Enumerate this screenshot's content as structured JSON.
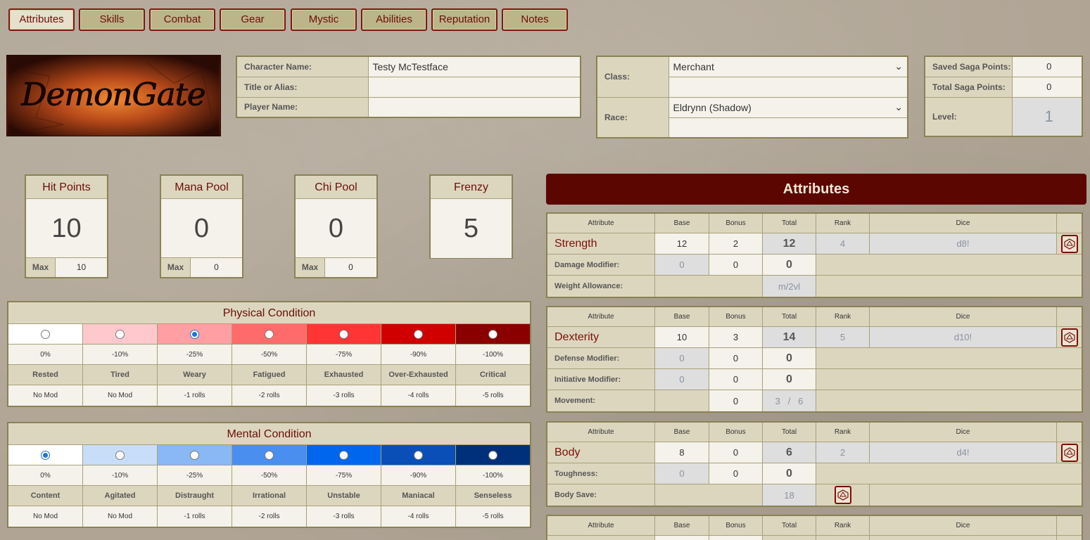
{
  "tabs": [
    "Attributes",
    "Skills",
    "Combat",
    "Gear",
    "Mystic",
    "Abilities",
    "Reputation",
    "Notes"
  ],
  "logo_text": "DemonGate",
  "character": {
    "name_label": "Character Name:",
    "name_value": "Testy McTestface",
    "title_label": "Title or Alias:",
    "title_value": "",
    "player_label": "Player Name:",
    "player_value": ""
  },
  "class_race": {
    "class_label": "Class:",
    "class_value": "Merchant",
    "race_label": "Race:",
    "race_value": "Eldrynn (Shadow)"
  },
  "saga": {
    "saved_label": "Saved Saga Points:",
    "saved_value": "0",
    "total_label": "Total Saga Points:",
    "total_value": "0",
    "level_label": "Level:",
    "level_value": "1"
  },
  "resources": [
    {
      "title": "Hit Points",
      "value": "10",
      "max_label": "Max",
      "max": "10"
    },
    {
      "title": "Mana Pool",
      "value": "0",
      "max_label": "Max",
      "max": "0"
    },
    {
      "title": "Chi Pool",
      "value": "0",
      "max_label": "Max",
      "max": "0"
    },
    {
      "title": "Frenzy",
      "value": "5"
    }
  ],
  "physical": {
    "title": "Physical Condition",
    "colors": [
      "#ffffff",
      "#ffc8cc",
      "#ff9fa3",
      "#ff6b6b",
      "#ff3434",
      "#d00000",
      "#8a0000"
    ],
    "selected": 2,
    "pcts": [
      "0%",
      "-10%",
      "-25%",
      "-50%",
      "-75%",
      "-90%",
      "-100%"
    ],
    "names": [
      "Rested",
      "Tired",
      "Weary",
      "Fatigued",
      "Exhausted",
      "Over-Exhausted",
      "Critical"
    ],
    "mods": [
      "No Mod",
      "No Mod",
      "-1 rolls",
      "-2 rolls",
      "-3 rolls",
      "-4 rolls",
      "-5 rolls"
    ]
  },
  "mental": {
    "title": "Mental Condition",
    "colors": [
      "#ffffff",
      "#c8def8",
      "#8ab8f4",
      "#4a8ef0",
      "#0066ee",
      "#0a4fb8",
      "#00307a"
    ],
    "selected": 0,
    "pcts": [
      "0%",
      "-10%",
      "-25%",
      "-50%",
      "-75%",
      "-90%",
      "-100%"
    ],
    "names": [
      "Content",
      "Agitated",
      "Distraught",
      "Irrational",
      "Unstable",
      "Maniacal",
      "Senseless"
    ],
    "mods": [
      "No Mod",
      "No Mod",
      "-1 rolls",
      "-2 rolls",
      "-3 rolls",
      "-4 rolls",
      "-5 rolls"
    ]
  },
  "attributes": {
    "title": "Attributes",
    "headers": [
      "Attribute",
      "Base",
      "Bonus",
      "Total",
      "Rank",
      "Dice"
    ],
    "strength": {
      "name": "Strength",
      "base": "12",
      "bonus": "2",
      "total": "12",
      "rank": "4",
      "dice": "d8!",
      "dmg_label": "Damage Modifier:",
      "dmg_base": "0",
      "dmg_bonus": "0",
      "dmg_total": "0",
      "weight_label": "Weight Allowance:",
      "weight_value": "m/2vl"
    },
    "dexterity": {
      "name": "Dexterity",
      "base": "10",
      "bonus": "3",
      "total": "14",
      "rank": "5",
      "dice": "d10!",
      "def_label": "Defense Modifier:",
      "def_base": "0",
      "def_bonus": "0",
      "def_total": "0",
      "init_label": "Initiative Modifier:",
      "init_base": "0",
      "init_bonus": "0",
      "init_total": "0",
      "move_label": "Movement:",
      "move_bonus": "0",
      "move_value": "3   /   6"
    },
    "body": {
      "name": "Body",
      "base": "8",
      "bonus": "0",
      "total": "6",
      "rank": "2",
      "dice": "d4!",
      "tough_label": "Toughness:",
      "tough_base": "0",
      "tough_bonus": "0",
      "tough_total": "0",
      "save_label": "Body Save:",
      "save_value": "18"
    }
  }
}
